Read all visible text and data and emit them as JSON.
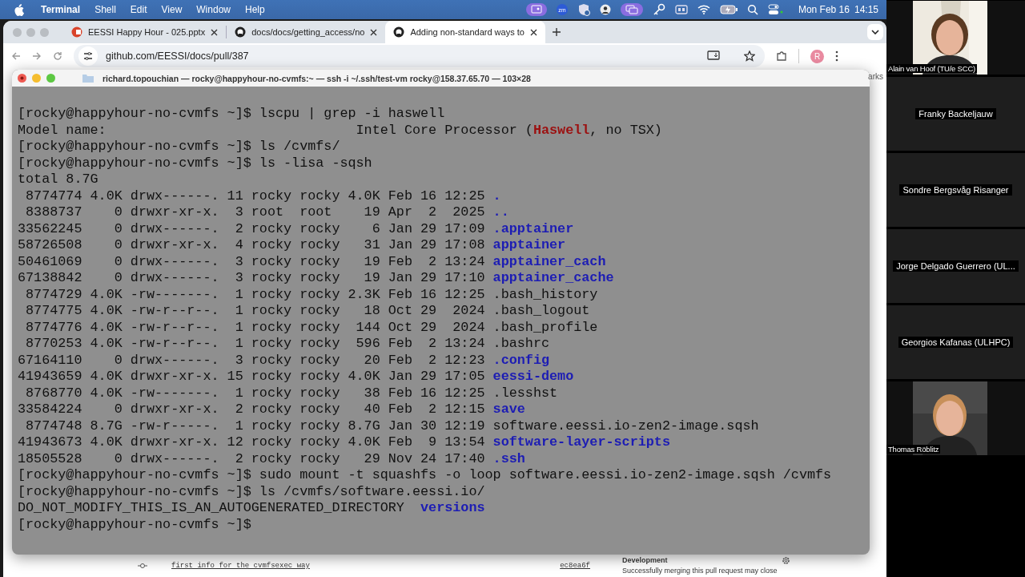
{
  "menubar": {
    "app": "Terminal",
    "menus": [
      "Shell",
      "Edit",
      "View",
      "Window",
      "Help"
    ],
    "zoom_badge": "zm",
    "date": "Mon Feb 16",
    "time": "14:15"
  },
  "browser": {
    "tabs": [
      {
        "title": "EESSI Happy Hour - 025.pptx",
        "kind": "slides",
        "selected": false
      },
      {
        "title": "docs/docs/getting_access/no",
        "kind": "github",
        "selected": false
      },
      {
        "title": "Adding non-standard ways to",
        "kind": "github",
        "selected": true
      }
    ],
    "url": "github.com/EESSI/docs/pull/387",
    "avatar": "R",
    "bookmarks_fragment": "arks",
    "page": {
      "commit_message": "first info for the cvmfsexec way",
      "commit_hash": "ec8ea6f",
      "sidebar_heading": "Development",
      "sidebar_text": "Successfully merging this pull request may close"
    }
  },
  "terminal": {
    "title": "richard.topouchian — rocky@happyhour-no-cvmfs:~ — ssh -i ~/.ssh/test-vm rocky@158.37.65.70 — 103×28",
    "lines": [
      [
        {
          "text": "[rocky@happyhour-no-cvmfs ~]$ lscpu | grep -i haswell",
          "kind": "plain"
        }
      ],
      [
        {
          "text": "Model name:                               Intel Core Processor (",
          "kind": "plain"
        },
        {
          "text": "Haswell",
          "kind": "match"
        },
        {
          "text": ", no TSX)",
          "kind": "plain"
        }
      ],
      [
        {
          "text": "[rocky@happyhour-no-cvmfs ~]$ ls /cvmfs/",
          "kind": "plain"
        }
      ],
      [
        {
          "text": "[rocky@happyhour-no-cvmfs ~]$ ls -lisa -sqsh",
          "kind": "plain"
        }
      ],
      [
        {
          "text": "total 8.7G",
          "kind": "plain"
        }
      ],
      [
        {
          "text": " 8774774 4.0K drwx------. 11 rocky rocky 4.0K Feb 16 12:25 ",
          "kind": "plain"
        },
        {
          "text": ".",
          "kind": "dir"
        }
      ],
      [
        {
          "text": " 8388737    0 drwxr-xr-x.  3 root  root    19 Apr  2  2025 ",
          "kind": "plain"
        },
        {
          "text": "..",
          "kind": "dir"
        }
      ],
      [
        {
          "text": "33562245    0 drwx------.  2 rocky rocky    6 Jan 29 17:09 ",
          "kind": "plain"
        },
        {
          "text": ".apptainer",
          "kind": "dir"
        }
      ],
      [
        {
          "text": "58726508    0 drwxr-xr-x.  4 rocky rocky   31 Jan 29 17:08 ",
          "kind": "plain"
        },
        {
          "text": "apptainer",
          "kind": "dir"
        }
      ],
      [
        {
          "text": "50461069    0 drwx------.  3 rocky rocky   19 Feb  2 13:24 ",
          "kind": "plain"
        },
        {
          "text": "apptainer_cach",
          "kind": "dir"
        }
      ],
      [
        {
          "text": "67138842    0 drwx------.  3 rocky rocky   19 Jan 29 17:10 ",
          "kind": "plain"
        },
        {
          "text": "apptainer_cache",
          "kind": "dir"
        }
      ],
      [
        {
          "text": " 8774729 4.0K -rw-------.  1 rocky rocky 2.3K Feb 16 12:25 .bash_history",
          "kind": "plain"
        }
      ],
      [
        {
          "text": " 8774775 4.0K -rw-r--r--.  1 rocky rocky   18 Oct 29  2024 .bash_logout",
          "kind": "plain"
        }
      ],
      [
        {
          "text": " 8774776 4.0K -rw-r--r--.  1 rocky rocky  144 Oct 29  2024 .bash_profile",
          "kind": "plain"
        }
      ],
      [
        {
          "text": " 8770253 4.0K -rw-r--r--.  1 rocky rocky  596 Feb  2 13:24 .bashrc",
          "kind": "plain"
        }
      ],
      [
        {
          "text": "67164110    0 drwx------.  3 rocky rocky   20 Feb  2 12:23 ",
          "kind": "plain"
        },
        {
          "text": ".config",
          "kind": "dir"
        }
      ],
      [
        {
          "text": "41943659 4.0K drwxr-xr-x. 15 rocky rocky 4.0K Jan 29 17:05 ",
          "kind": "plain"
        },
        {
          "text": "eessi-demo",
          "kind": "dir"
        }
      ],
      [
        {
          "text": " 8768770 4.0K -rw-------.  1 rocky rocky   38 Feb 16 12:25 .lesshst",
          "kind": "plain"
        }
      ],
      [
        {
          "text": "33584224    0 drwxr-xr-x.  2 rocky rocky   40 Feb  2 12:15 ",
          "kind": "plain"
        },
        {
          "text": "save",
          "kind": "dir"
        }
      ],
      [
        {
          "text": " 8774748 8.7G -rw-r-----.  1 rocky rocky 8.7G Jan 30 12:19 software.eessi.io-zen2-image.sqsh",
          "kind": "plain"
        }
      ],
      [
        {
          "text": "41943673 4.0K drwxr-xr-x. 12 rocky rocky 4.0K Feb  9 13:54 ",
          "kind": "plain"
        },
        {
          "text": "software-layer-scripts",
          "kind": "dir"
        }
      ],
      [
        {
          "text": "18505528    0 drwx------.  2 rocky rocky   29 Nov 24 17:40 ",
          "kind": "plain"
        },
        {
          "text": ".ssh",
          "kind": "dir"
        }
      ],
      [
        {
          "text": "[rocky@happyhour-no-cvmfs ~]$ sudo mount -t squashfs -o loop software.eessi.io-zen2-image.sqsh /cvmfs",
          "kind": "plain"
        }
      ],
      [
        {
          "text": "[rocky@happyhour-no-cvmfs ~]$ ls /cvmfs/software.eessi.io/",
          "kind": "plain"
        }
      ],
      [
        {
          "text": "DO_NOT_MODIFY_THIS_IS_AN_AUTOGENERATED_DIRECTORY  ",
          "kind": "plain"
        },
        {
          "text": "versions",
          "kind": "dir"
        }
      ],
      [
        {
          "text": "[rocky@happyhour-no-cvmfs ~]$",
          "kind": "plain"
        }
      ]
    ]
  },
  "participants": [
    {
      "name": "Alain van Hoof (TU/e SCC)",
      "kind": "video"
    },
    {
      "name": "Franky Backeljauw",
      "kind": "name"
    },
    {
      "name": "Sondre Bergsvåg Risanger",
      "kind": "name"
    },
    {
      "name": "Jorge Delgado Guerrero (UL...",
      "kind": "name"
    },
    {
      "name": "Georgios Kafanas (ULHPC)",
      "kind": "name"
    },
    {
      "name": "Thomas Röblitz",
      "kind": "video"
    }
  ]
}
